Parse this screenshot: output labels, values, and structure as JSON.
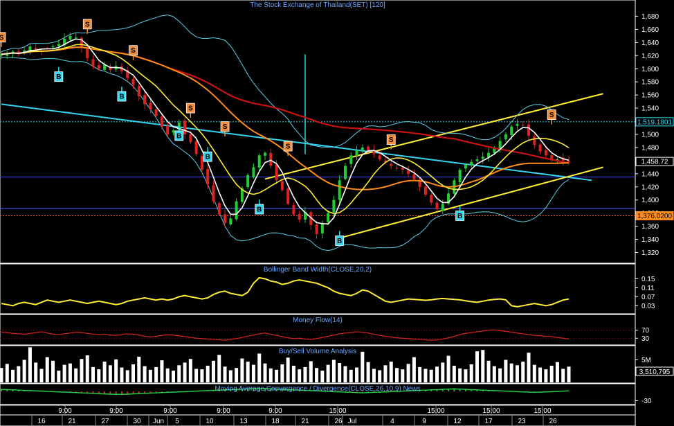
{
  "colors": {
    "background": "#000000",
    "up_candle": "#22cc33",
    "down_candle": "#dd2222",
    "sma_fast": "#ffffff",
    "sma_mid": "#ffee33",
    "sma_slow": "#ff8c1a",
    "sma_long": "#cc1111",
    "bollinger": "#5ccfe6",
    "trendline_down": "#33d6f0",
    "trendline_channel": "#ffee33",
    "buy_signal": "#33d6f0",
    "sell_signal": "#f08c3a",
    "title": "#6fa8ff"
  },
  "panels": {
    "price": {
      "title": "The Stock Exchange of Thailand(SET) [120]"
    },
    "bbw": {
      "title": "Bollinger Band Width(CLOSE,20,2)"
    },
    "mfi": {
      "title": "Money Flow(14)"
    },
    "volume": {
      "title": "Buy/Sell Volume Analysis"
    },
    "macd": {
      "title": "Moving Average Convergence / Divergence(CLOSE,26,10,9) News"
    }
  },
  "chart_data": [
    {
      "type": "candlestick",
      "panel": "price",
      "title": "The Stock Exchange of Thailand(SET) [120]",
      "ylim": [
        1310,
        1690
      ],
      "y_ticks": [
        "1,680",
        "1,660",
        "1,640",
        "1,620",
        "1,600",
        "1,580",
        "1,560",
        "1,540",
        "1,520",
        "1,500",
        "1,480",
        "1,460",
        "1,440",
        "1,420",
        "1,400",
        "1,380",
        "1,360",
        "1,340",
        "1,320"
      ],
      "price_tags": [
        {
          "label": "1,519.1801",
          "value": 1519.18,
          "style": "cyan"
        },
        {
          "label": "1,458.72",
          "value": 1458.72,
          "style": "white"
        },
        {
          "label": "1,376.0200",
          "value": 1376.02,
          "style": "orange"
        }
      ],
      "horizontal_levels": [
        1519.18,
        1435,
        1387,
        1376.02
      ],
      "close_series": [
        1622,
        1624,
        1626,
        1622,
        1628,
        1634,
        1630,
        1628,
        1630,
        1634,
        1638,
        1646,
        1650,
        1648,
        1632,
        1616,
        1604,
        1600,
        1606,
        1598,
        1604,
        1596,
        1586,
        1576,
        1558,
        1546,
        1538,
        1528,
        1512,
        1500,
        1506,
        1518,
        1500,
        1488,
        1470,
        1446,
        1424,
        1398,
        1378,
        1365,
        1372,
        1398,
        1418,
        1438,
        1450,
        1468,
        1472,
        1452,
        1430,
        1415,
        1394,
        1378,
        1370,
        1382,
        1362,
        1348,
        1364,
        1380,
        1400,
        1430,
        1452,
        1468,
        1476,
        1480,
        1476,
        1470,
        1462,
        1458,
        1452,
        1448,
        1446,
        1440,
        1432,
        1420,
        1408,
        1396,
        1386,
        1394,
        1410,
        1430,
        1446,
        1454,
        1458,
        1462,
        1466,
        1472,
        1480,
        1490,
        1500,
        1512,
        1516,
        1514,
        1498,
        1484,
        1474,
        1468,
        1462,
        1462,
        1460,
        1458
      ],
      "signals": [
        {
          "type": "S",
          "label": "S",
          "index": 0,
          "value": 1648
        },
        {
          "type": "S",
          "label": "S",
          "index": 15,
          "value": 1668
        },
        {
          "type": "S",
          "label": "S",
          "index": 23,
          "value": 1628
        },
        {
          "type": "S",
          "label": "S",
          "index": 33,
          "value": 1540
        },
        {
          "type": "S",
          "label": "S",
          "index": 39,
          "value": 1512
        },
        {
          "type": "S",
          "label": "S",
          "index": 50,
          "value": 1482
        },
        {
          "type": "S",
          "label": "S",
          "index": 68,
          "value": 1492
        },
        {
          "type": "S",
          "label": "S",
          "index": 96,
          "value": 1530
        },
        {
          "type": "B",
          "label": "B",
          "index": 10,
          "value": 1588
        },
        {
          "type": "B",
          "label": "B",
          "index": 21,
          "value": 1558
        },
        {
          "type": "B",
          "label": "B",
          "index": 31,
          "value": 1498
        },
        {
          "type": "B",
          "label": "B",
          "index": 36,
          "value": 1466
        },
        {
          "type": "B",
          "label": "B",
          "index": 45,
          "value": 1386
        },
        {
          "type": "B",
          "label": "B",
          "index": 59,
          "value": 1338
        },
        {
          "type": "B",
          "label": "B",
          "index": 80,
          "value": 1376
        }
      ]
    },
    {
      "type": "line",
      "panel": "bbw",
      "title": "Bollinger Band Width(CLOSE,20,2)",
      "ylim": [
        0.0,
        0.17
      ],
      "y_ticks": [
        "0.15",
        "0.11",
        "0.07",
        "0.03"
      ],
      "values": [
        0.04,
        0.035,
        0.03,
        0.04,
        0.045,
        0.04,
        0.035,
        0.045,
        0.055,
        0.05,
        0.045,
        0.05,
        0.055,
        0.05,
        0.045,
        0.04,
        0.045,
        0.05,
        0.045,
        0.04,
        0.035,
        0.04,
        0.05,
        0.055,
        0.06,
        0.065,
        0.06,
        0.055,
        0.06,
        0.055,
        0.06,
        0.07,
        0.075,
        0.07,
        0.065,
        0.06,
        0.065,
        0.08,
        0.09,
        0.095,
        0.085,
        0.08,
        0.075,
        0.09,
        0.13,
        0.155,
        0.15,
        0.14,
        0.135,
        0.125,
        0.13,
        0.14,
        0.145,
        0.14,
        0.135,
        0.13,
        0.12,
        0.11,
        0.095,
        0.085,
        0.08,
        0.075,
        0.085,
        0.1,
        0.095,
        0.08,
        0.065,
        0.05,
        0.045,
        0.05,
        0.055,
        0.06,
        0.058,
        0.056,
        0.054,
        0.056,
        0.06,
        0.062,
        0.06,
        0.058,
        0.056,
        0.052,
        0.048,
        0.045,
        0.05,
        0.055,
        0.058,
        0.06,
        0.056,
        0.03,
        0.025,
        0.03,
        0.035,
        0.04,
        0.035,
        0.03,
        0.035,
        0.045,
        0.055,
        0.06
      ]
    },
    {
      "type": "line",
      "panel": "mfi",
      "title": "Money Flow(14)",
      "ylim": [
        0,
        100
      ],
      "y_ticks": [
        "70",
        "30"
      ],
      "values": [
        60,
        58,
        55,
        52,
        50,
        54,
        58,
        62,
        56,
        50,
        48,
        52,
        56,
        60,
        58,
        54,
        50,
        48,
        50,
        46,
        44,
        48,
        52,
        50,
        46,
        40,
        36,
        40,
        44,
        48,
        46,
        42,
        38,
        34,
        30,
        28,
        26,
        24,
        22,
        20,
        24,
        28,
        34,
        40,
        46,
        52,
        56,
        50,
        44,
        38,
        32,
        28,
        30,
        26,
        24,
        28,
        34,
        40,
        46,
        52,
        56,
        58,
        62,
        60,
        56,
        50,
        44,
        40,
        36,
        32,
        30,
        28,
        26,
        24,
        22,
        20,
        22,
        26,
        32,
        40,
        48,
        54,
        58,
        62,
        66,
        70,
        72,
        68,
        64,
        60,
        56,
        52,
        48,
        44,
        42,
        40,
        38,
        34,
        30,
        26
      ]
    },
    {
      "type": "bar",
      "panel": "volume",
      "title": "Buy/Sell Volume Analysis",
      "ylim": [
        0,
        8
      ],
      "y_ticks": [
        "5M"
      ],
      "last_value_label": "3,510,795",
      "values": [
        3.2,
        4.1,
        2.8,
        3.6,
        5.0,
        7.8,
        4.4,
        3.0,
        5.6,
        4.8,
        2.6,
        3.9,
        4.2,
        3.1,
        5.2,
        6.0,
        3.4,
        2.9,
        4.6,
        3.8,
        5.1,
        3.3,
        2.7,
        4.0,
        5.7,
        3.6,
        2.8,
        3.4,
        4.9,
        3.1,
        2.6,
        3.8,
        4.4,
        5.2,
        3.0,
        2.9,
        3.7,
        4.8,
        6.1,
        3.5,
        2.7,
        3.2,
        5.3,
        4.6,
        3.9,
        6.4,
        4.2,
        3.1,
        2.8,
        4.0,
        5.5,
        3.7,
        2.9,
        3.4,
        4.7,
        3.2,
        2.6,
        3.9,
        5.0,
        4.3,
        3.6,
        2.8,
        3.3,
        6.8,
        4.5,
        3.0,
        2.7,
        3.8,
        4.6,
        3.2,
        2.9,
        4.1,
        5.6,
        3.4,
        3.0,
        2.8,
        3.5,
        4.4,
        5.9,
        3.7,
        3.1,
        2.9,
        4.0,
        6.9,
        7.2,
        4.8,
        3.6,
        3.1,
        5.0,
        4.2,
        3.8,
        4.6,
        6.6,
        3.9,
        3.3,
        2.9,
        3.7,
        4.5,
        3.0,
        3.5
      ]
    },
    {
      "type": "area",
      "panel": "macd",
      "title": "Moving Average Convergence / Divergence(CLOSE,26,10,9) News",
      "ylim": [
        -40,
        20
      ],
      "y_ticks": [
        "-30"
      ],
      "values": [
        8,
        7,
        6,
        5,
        4,
        3,
        2,
        1,
        0,
        -1,
        -2,
        -3,
        -4,
        -5,
        -6,
        -7,
        -8,
        -9,
        -10,
        -11,
        -12,
        -12,
        -11,
        -10,
        -9,
        -8,
        -7,
        -6,
        -5,
        -4,
        -3,
        -2,
        -1,
        0,
        1,
        2,
        3,
        4,
        5,
        6,
        7,
        8,
        9,
        10,
        11,
        12,
        11,
        10,
        9,
        8,
        7,
        6,
        5,
        4,
        3,
        2,
        1,
        0,
        -1,
        -2,
        -3,
        -4,
        -5,
        -6,
        -5,
        -4,
        -3,
        -2,
        -1,
        0,
        1,
        2,
        3,
        4,
        5,
        6,
        7,
        8,
        9,
        10,
        9,
        8,
        7,
        6,
        5,
        4,
        3,
        2,
        1,
        0,
        -1,
        -2,
        -3,
        -4,
        -3,
        -2,
        -1,
        0,
        1,
        2
      ]
    }
  ],
  "x_axis": {
    "time_labels": [
      "9:00",
      "9:00",
      "9:00",
      "9:00",
      "9:00",
      "15:00",
      "15:00",
      "15:00",
      "15:00"
    ],
    "date_labels": [
      "16",
      "21",
      "27",
      "30",
      "Jun",
      "5",
      "10",
      "13",
      "18",
      "21",
      "26",
      "Jul",
      "4",
      "9",
      "12",
      "17",
      "23",
      "26"
    ]
  }
}
